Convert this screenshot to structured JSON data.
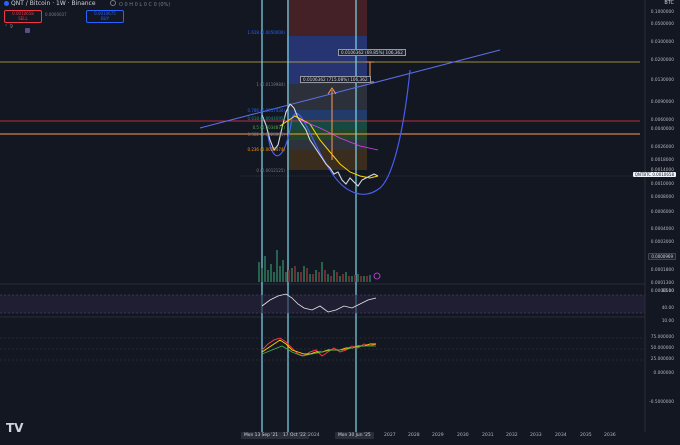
{
  "header": {
    "symbol": "QNT / Bitcoin · 1W · Binance",
    "ohlc": "O 0 H 0 L 0 C 0 (0%)",
    "sell_price": "0.0010658",
    "sell_label": "SELL",
    "spread": "0.0000037",
    "buy_price": "0.0010675",
    "buy_label": "BUY",
    "indicator_count": "9"
  },
  "price_axis": {
    "currency": "BTC",
    "labels": [
      "0.1000000",
      "0.0500000",
      "0.0300000",
      "0.0200000",
      "0.0130000",
      "0.0090000",
      "0.0060000",
      "0.0040000",
      "0.0026000",
      "0.0018000",
      "0.0014000",
      "0.0010000",
      "0.0008000",
      "0.0006000",
      "0.0004000",
      "0.0003000",
      "0.0002300",
      "0.0001800",
      "0.0001300",
      "0.0000510"
    ],
    "current_tag": "QNTBTC",
    "current_value": "0.0010658",
    "volume_value": "0.0000969"
  },
  "osc1_axis": [
    "80.00",
    "40.00",
    "10.00"
  ],
  "osc2_axis": [
    "75.000000",
    "50.000000",
    "25.000000",
    "0.000000",
    "-0.5000000"
  ],
  "fib_levels": [
    {
      "label": "1.618 (0.0050000)",
      "color": "#2962ff"
    },
    {
      "label": "1 (0.0119984)",
      "color": "#787b86"
    },
    {
      "label": "0.786 (0.0057434)",
      "color": "#2962ff"
    },
    {
      "label": "0.618 (0.0044095)",
      "color": "#089981"
    },
    {
      "label": "0.5 (0.0034871)",
      "color": "#4caf50"
    },
    {
      "label": "0.382 (0.0028085)",
      "color": "#787b86"
    },
    {
      "label": "0.236 (0.0020474)",
      "color": "#ff9800"
    },
    {
      "label": "0 (0.0012125)",
      "color": "#787b86"
    }
  ],
  "measures": [
    {
      "text": "0.0106362 (69.85%) 106,362"
    },
    {
      "text": "0.0106362 (715.08%) 106,362"
    }
  ],
  "dates": [
    "Mon 13 Sep '21",
    "17 Oct '22",
    "Mon 30 Jun '25"
  ],
  "years": [
    "2024",
    "2027",
    "2028",
    "2029",
    "2030",
    "2031",
    "2032",
    "2033",
    "2034",
    "2035",
    "2036"
  ],
  "logo": "TV"
}
